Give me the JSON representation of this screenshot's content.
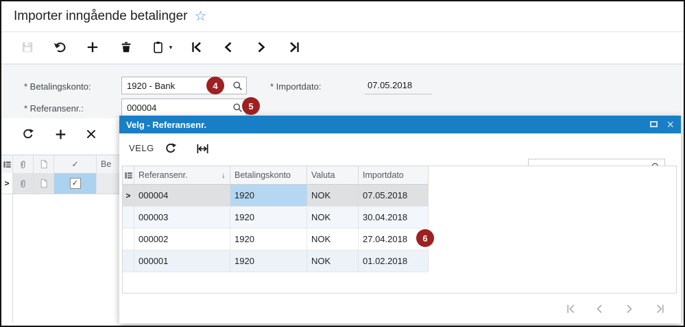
{
  "window": {
    "title": "Importer inngående betalinger"
  },
  "icons": {
    "star": "☆",
    "caret_down": "▼",
    "check": "✓",
    "close": "×",
    "sort_desc": "↓",
    "row_indicator": ">"
  },
  "main_toolbar": {
    "icons": [
      "save",
      "undo",
      "add",
      "delete",
      "clipboard",
      "go-first",
      "go-previous",
      "go-next",
      "go-last"
    ]
  },
  "form": {
    "betalingskonto": {
      "label": "* Betalingskonto:",
      "value": "1920 - Bank"
    },
    "referansenr": {
      "label": "* Referansenr.:",
      "value": "000004"
    },
    "importdato": {
      "label": "* Importdato:",
      "value": "07.05.2018"
    }
  },
  "callouts": {
    "betalingskonto": "4",
    "referansenr": "5",
    "grid_row": "6"
  },
  "left_grid": {
    "toolbar_icons": [
      "refresh",
      "add",
      "cancel"
    ],
    "header": {
      "check_column": "✓",
      "partial_column": "Be"
    },
    "row": {
      "checked": true
    }
  },
  "dialog": {
    "title": "Velg - Referansenr.",
    "select_button": "VELG",
    "toolbar_icons": [
      "refresh",
      "fit-width"
    ],
    "search_value": "",
    "grid": {
      "columns": [
        "Referansenr.",
        "Betalingskonto",
        "Valuta",
        "Importdato"
      ],
      "sort_column": "Referansenr.",
      "sort_direction": "desc",
      "selected_row": "000004",
      "rows": [
        {
          "referansenr": "000004",
          "betalingskonto": "1920",
          "valuta": "NOK",
          "importdato": "07.05.2018"
        },
        {
          "referansenr": "000003",
          "betalingskonto": "1920",
          "valuta": "NOK",
          "importdato": "30.04.2018"
        },
        {
          "referansenr": "000002",
          "betalingskonto": "1920",
          "valuta": "NOK",
          "importdato": "27.04.2018"
        },
        {
          "referansenr": "000001",
          "betalingskonto": "1920",
          "valuta": "NOK",
          "importdato": "01.02.2018"
        }
      ]
    },
    "pager_icons": [
      "go-first",
      "go-previous",
      "go-next",
      "go-last"
    ]
  },
  "colors": {
    "titlebar_blue": "#187fc7",
    "callout_red": "#9e2021",
    "selected_row": "#dfe0e2",
    "active_cell": "#b5d7f1",
    "alt_row": "#f3f6fa",
    "alt_row2": "#edf2f9",
    "star_blue": "#4e9bd4"
  }
}
